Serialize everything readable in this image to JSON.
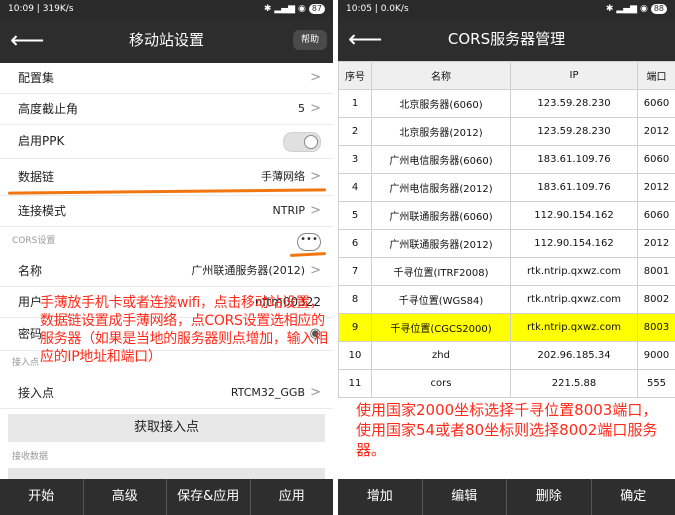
{
  "left": {
    "status": {
      "time": "10:09",
      "speed": "319K/s",
      "battery": "87"
    },
    "title": "移动站设置",
    "help_label": "帮助",
    "rows": {
      "config": {
        "label": "配置集"
      },
      "cutoff": {
        "label": "高度截止角",
        "value": "5"
      },
      "ppk": {
        "label": "启用PPK"
      },
      "datalink": {
        "label": "数据链",
        "value": "手薄网络"
      },
      "mode": {
        "label": "连接模式",
        "value": "NTRIP"
      },
      "cors_section": "CORS设置",
      "name": {
        "label": "名称",
        "value": "广州联通服务器(2012)"
      },
      "user": {
        "label": "用户",
        "value": "nftm00322"
      },
      "password": {
        "label": "密码"
      },
      "access_section": "接入点",
      "access": {
        "label": "接入点",
        "value": "RTCM32_GGB"
      },
      "receive_section": "接收数据"
    },
    "get_button": "获取接入点",
    "bottom": [
      "开始",
      "高级",
      "保存&应用",
      "应用"
    ],
    "annotation": "手薄放手机卡或者连接wifi，点击移动站设置，数据链设置成手薄网络，点CORS设置选相应的服务器（如果是当地的服务器则点增加，输入相应的IP地址和端口）"
  },
  "right": {
    "status": {
      "time": "10:05",
      "speed": "0.0K/s",
      "battery": "88"
    },
    "title": "CORS服务器管理",
    "columns": [
      "序号",
      "名称",
      "IP",
      "端口"
    ],
    "servers": [
      {
        "no": "1",
        "name": "北京服务器(6060)",
        "ip": "123.59.28.230",
        "port": "6060"
      },
      {
        "no": "2",
        "name": "北京服务器(2012)",
        "ip": "123.59.28.230",
        "port": "2012"
      },
      {
        "no": "3",
        "name": "广州电信服务器(6060)",
        "ip": "183.61.109.76",
        "port": "6060"
      },
      {
        "no": "4",
        "name": "广州电信服务器(2012)",
        "ip": "183.61.109.76",
        "port": "2012"
      },
      {
        "no": "5",
        "name": "广州联通服务器(6060)",
        "ip": "112.90.154.162",
        "port": "6060"
      },
      {
        "no": "6",
        "name": "广州联通服务器(2012)",
        "ip": "112.90.154.162",
        "port": "2012"
      },
      {
        "no": "7",
        "name": "千寻位置(ITRF2008)",
        "ip": "rtk.ntrip.qxwz.com",
        "port": "8001"
      },
      {
        "no": "8",
        "name": "千寻位置(WGS84)",
        "ip": "rtk.ntrip.qxwz.com",
        "port": "8002"
      },
      {
        "no": "9",
        "name": "千寻位置(CGCS2000)",
        "ip": "rtk.ntrip.qxwz.com",
        "port": "8003",
        "selected": true
      },
      {
        "no": "10",
        "name": "zhd",
        "ip": "202.96.185.34",
        "port": "9000"
      },
      {
        "no": "11",
        "name": "cors",
        "ip": "221.5.88",
        "port": "555"
      }
    ],
    "note": "使用国家2000坐标选择千寻位置8003端口，使用国家54或者80坐标则选择8002端口服务器。",
    "bottom": [
      "增加",
      "编辑",
      "删除",
      "确定"
    ]
  },
  "colors": {
    "annotation": "#ff2a1a",
    "underline": "#f2760f",
    "highlight": "#ffff00",
    "bar": "#2d2d2d"
  }
}
